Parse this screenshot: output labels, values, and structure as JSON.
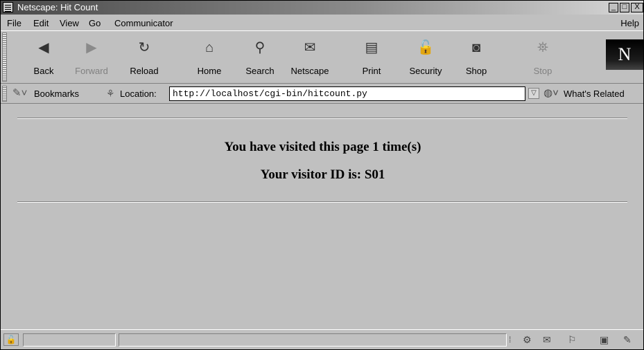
{
  "window": {
    "title": "Netscape: Hit Count",
    "controls": {
      "minimize": "_",
      "maximize": "□",
      "close": "X"
    }
  },
  "menubar": {
    "items": [
      "File",
      "Edit",
      "View",
      "Go",
      "Communicator"
    ],
    "help": "Help"
  },
  "toolbar": {
    "buttons": [
      {
        "label": "Back",
        "icon": "back-arrow-icon",
        "enabled": true
      },
      {
        "label": "Forward",
        "icon": "forward-arrow-icon",
        "enabled": false
      },
      {
        "label": "Reload",
        "icon": "reload-icon",
        "enabled": true
      },
      {
        "label": "Home",
        "icon": "home-icon",
        "enabled": true
      },
      {
        "label": "Search",
        "icon": "search-icon",
        "enabled": true
      },
      {
        "label": "Netscape",
        "icon": "netscape-mail-icon",
        "enabled": true
      },
      {
        "label": "Print",
        "icon": "print-icon",
        "enabled": true
      },
      {
        "label": "Security",
        "icon": "lock-icon",
        "enabled": true
      },
      {
        "label": "Shop",
        "icon": "shop-bag-icon",
        "enabled": true
      },
      {
        "label": "Stop",
        "icon": "stop-icon",
        "enabled": false
      }
    ],
    "logo": "N"
  },
  "locationbar": {
    "bookmarks_label": "Bookmarks",
    "location_label": "Location:",
    "url": "http://localhost/cgi-bin/hitcount.py",
    "related_label": "What's Related"
  },
  "content": {
    "visit_message": "You have visited this page 1 time(s)",
    "visitor_id": "Your visitor ID is: S01"
  },
  "statusbar": {
    "status_text": ""
  }
}
